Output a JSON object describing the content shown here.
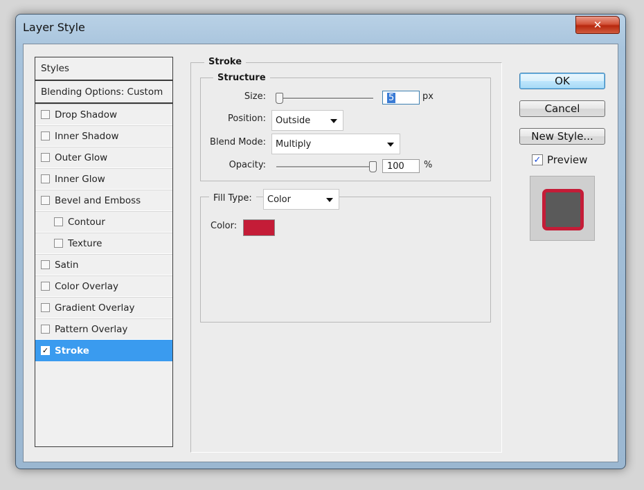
{
  "window": {
    "title": "Layer Style",
    "close_glyph": "✕"
  },
  "styles_list": {
    "header": "Styles",
    "blending": "Blending Options: Custom",
    "items": [
      {
        "label": "Drop Shadow",
        "checked": false,
        "indent": false
      },
      {
        "label": "Inner Shadow",
        "checked": false,
        "indent": false
      },
      {
        "label": "Outer Glow",
        "checked": false,
        "indent": false
      },
      {
        "label": "Inner Glow",
        "checked": false,
        "indent": false
      },
      {
        "label": "Bevel and Emboss",
        "checked": false,
        "indent": false
      },
      {
        "label": "Contour",
        "checked": false,
        "indent": true
      },
      {
        "label": "Texture",
        "checked": false,
        "indent": true
      },
      {
        "label": "Satin",
        "checked": false,
        "indent": false
      },
      {
        "label": "Color Overlay",
        "checked": false,
        "indent": false
      },
      {
        "label": "Gradient Overlay",
        "checked": false,
        "indent": false
      },
      {
        "label": "Pattern Overlay",
        "checked": false,
        "indent": false
      },
      {
        "label": "Stroke",
        "checked": true,
        "indent": false,
        "selected": true
      }
    ]
  },
  "stroke": {
    "title": "Stroke",
    "structure_title": "Structure",
    "size_label": "Size:",
    "size_value": "5",
    "size_unit": "px",
    "size_slider_fraction": 0.02,
    "position_label": "Position:",
    "position_value": "Outside",
    "blend_label": "Blend Mode:",
    "blend_value": "Multiply",
    "opacity_label": "Opacity:",
    "opacity_value": "100",
    "opacity_unit": "%",
    "opacity_slider_fraction": 1.0,
    "fill_type_label": "Fill Type:",
    "fill_type_value": "Color",
    "color_label": "Color:",
    "color_hex": "#c41c37"
  },
  "buttons": {
    "ok": "OK",
    "cancel": "Cancel",
    "new_style": "New Style..."
  },
  "preview": {
    "label": "Preview",
    "checked": true
  },
  "colors": {
    "accent_selected": "#3a9bef",
    "stroke_color": "#c41c37"
  }
}
